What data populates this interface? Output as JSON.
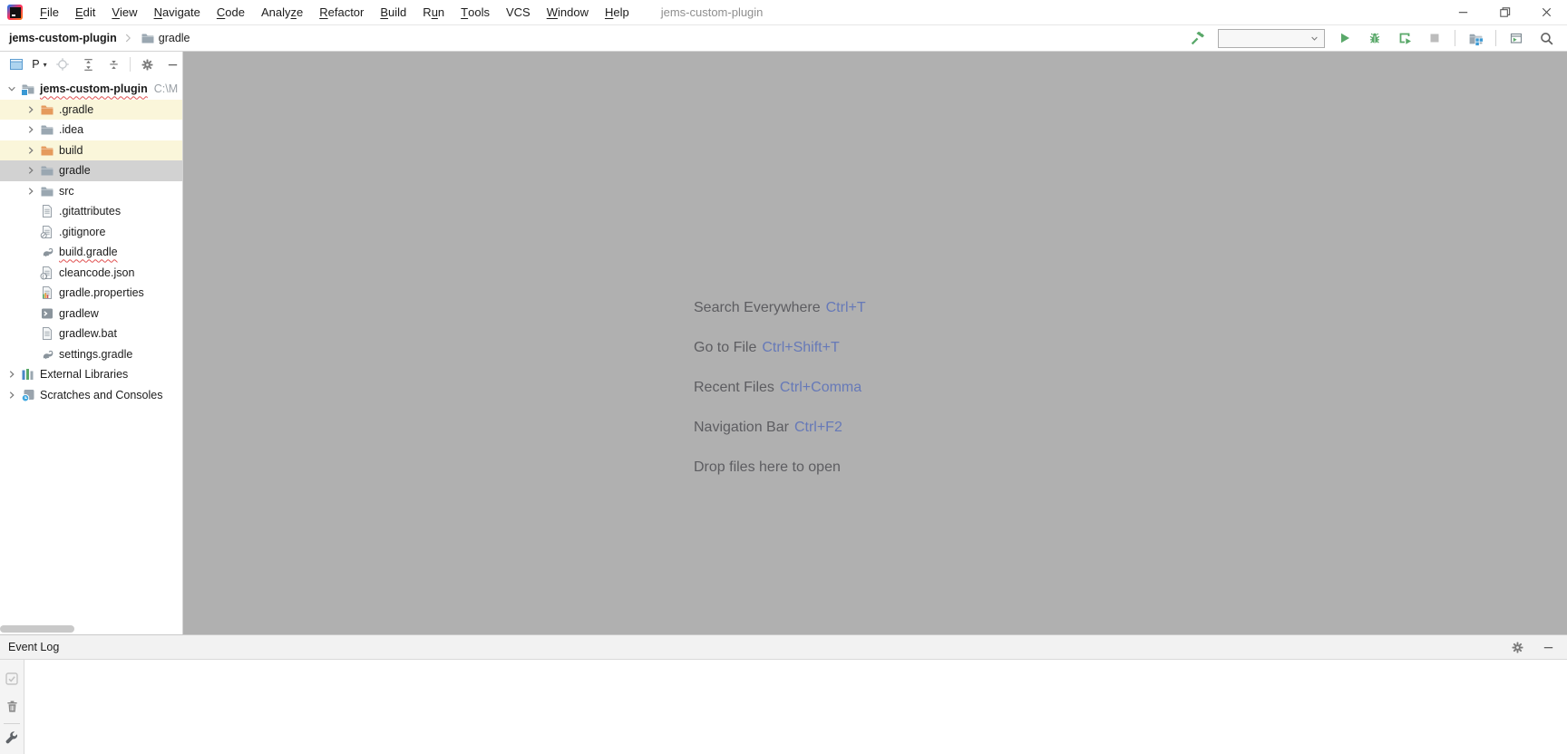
{
  "window": {
    "title": "jems-custom-plugin",
    "controls": [
      {
        "icon": "minimize",
        "name": "minimize-button"
      },
      {
        "icon": "restore",
        "name": "restore-button"
      },
      {
        "icon": "close",
        "name": "close-button"
      }
    ]
  },
  "menu": {
    "items": [
      {
        "label": "File",
        "mnemonic": 0
      },
      {
        "label": "Edit",
        "mnemonic": 0
      },
      {
        "label": "View",
        "mnemonic": 0
      },
      {
        "label": "Navigate",
        "mnemonic": 0
      },
      {
        "label": "Code",
        "mnemonic": 0
      },
      {
        "label": "Analyze",
        "mnemonic": 5
      },
      {
        "label": "Refactor",
        "mnemonic": 0
      },
      {
        "label": "Build",
        "mnemonic": 0
      },
      {
        "label": "Run",
        "mnemonic": 1
      },
      {
        "label": "Tools",
        "mnemonic": 0
      },
      {
        "label": "VCS",
        "mnemonic": -1
      },
      {
        "label": "Window",
        "mnemonic": 0
      },
      {
        "label": "Help",
        "mnemonic": 0
      }
    ]
  },
  "breadcrumb": {
    "root": "jems-custom-plugin",
    "current": "gradle",
    "current_icon": "folder"
  },
  "toolbar": {
    "buttons": [
      {
        "icon": "hammer",
        "name": "build-project-button"
      },
      {
        "combobox": true,
        "icon": "chevron-down-small",
        "name": "run-config-select",
        "value": ""
      },
      {
        "icon": "run",
        "name": "run-button"
      },
      {
        "icon": "debug",
        "name": "debug-button"
      },
      {
        "icon": "coverage",
        "name": "run-with-coverage-button"
      },
      {
        "icon": "stop",
        "name": "stop-button"
      },
      {
        "sep": true
      },
      {
        "icon": "project-structure",
        "name": "project-structure-button"
      },
      {
        "sep": true
      },
      {
        "icon": "tool-window",
        "name": "run-anything-button"
      },
      {
        "icon": "search",
        "name": "search-everywhere-button"
      }
    ]
  },
  "project_panel": {
    "tab_label": "P",
    "header_icons": [
      {
        "icon": "project-tab",
        "name": "project-tool-window-icon"
      },
      {
        "tab": true
      },
      {
        "icon": "locate",
        "name": "select-opened-file-button"
      },
      {
        "icon": "expand-all",
        "name": "expand-all-button"
      },
      {
        "icon": "collapse-all",
        "name": "collapse-all-button"
      },
      {
        "sep": true
      },
      {
        "icon": "gear",
        "name": "panel-settings-button"
      },
      {
        "icon": "minimize",
        "name": "hide-panel-button"
      }
    ],
    "tree": [
      {
        "label": "jems-custom-plugin",
        "suffix": "C:\\M",
        "icon": "folder-root",
        "depth": 0,
        "chevron": "expanded",
        "bold": true,
        "squiggle": true
      },
      {
        "label": ".gradle",
        "icon": "folder-excluded",
        "depth": 1,
        "chevron": "collapsed",
        "bg": "yellow"
      },
      {
        "label": ".idea",
        "icon": "folder",
        "depth": 1,
        "chevron": "collapsed"
      },
      {
        "label": "build",
        "icon": "folder-excluded",
        "depth": 1,
        "chevron": "collapsed",
        "bg": "yellow"
      },
      {
        "label": "gradle",
        "icon": "folder",
        "depth": 1,
        "chevron": "collapsed",
        "selected": true
      },
      {
        "label": "src",
        "icon": "folder",
        "depth": 1,
        "chevron": "collapsed"
      },
      {
        "label": ".gitattributes",
        "icon": "file-text",
        "depth": 1,
        "chevron": "none"
      },
      {
        "label": ".gitignore",
        "icon": "file-ignore",
        "depth": 1,
        "chevron": "none"
      },
      {
        "label": "build.gradle",
        "icon": "gradle-file",
        "depth": 1,
        "chevron": "none",
        "squiggle": true
      },
      {
        "label": "cleancode.json",
        "icon": "json-file",
        "depth": 1,
        "chevron": "none"
      },
      {
        "label": "gradle.properties",
        "icon": "properties-file",
        "depth": 1,
        "chevron": "none"
      },
      {
        "label": "gradlew",
        "icon": "shell-script",
        "depth": 1,
        "chevron": "none"
      },
      {
        "label": "gradlew.bat",
        "icon": "file-text",
        "depth": 1,
        "chevron": "none"
      },
      {
        "label": "settings.gradle",
        "icon": "gradle-file",
        "depth": 1,
        "chevron": "none"
      },
      {
        "label": "External Libraries",
        "icon": "external-libraries",
        "depth": 0,
        "chevron": "collapsed"
      },
      {
        "label": "Scratches and Consoles",
        "icon": "scratches",
        "depth": 0,
        "chevron": "collapsed"
      }
    ]
  },
  "editor": {
    "shortcuts": [
      {
        "label": "Search Everywhere",
        "keys": "Ctrl+T"
      },
      {
        "label": "Go to File",
        "keys": "Ctrl+Shift+T"
      },
      {
        "label": "Recent Files",
        "keys": "Ctrl+Comma"
      },
      {
        "label": "Navigation Bar",
        "keys": "Ctrl+F2"
      },
      {
        "label": "Drop files here to open",
        "keys": ""
      }
    ]
  },
  "event_log": {
    "label": "Event Log",
    "right_icons": [
      {
        "icon": "gear",
        "name": "event-log-settings-button"
      },
      {
        "icon": "minimize",
        "name": "hide-event-log-button"
      }
    ],
    "strip_icons": [
      {
        "icon": "checkbox-check",
        "name": "mark-all-read-button"
      },
      {
        "icon": "trash",
        "name": "clear-all-button"
      },
      {
        "sep": true
      },
      {
        "icon": "wrench",
        "name": "event-log-config-button"
      }
    ]
  },
  "colors": {
    "selection_gray": "#d2d2d2",
    "excluded_row_bg": "#faf6da",
    "excluded_folder": "#e59a5c",
    "folder_gray": "#9aa7b1",
    "run_green": "#59a869",
    "shortcut_key_blue": "#6679b8",
    "editor_bg": "#b0b0b0"
  }
}
